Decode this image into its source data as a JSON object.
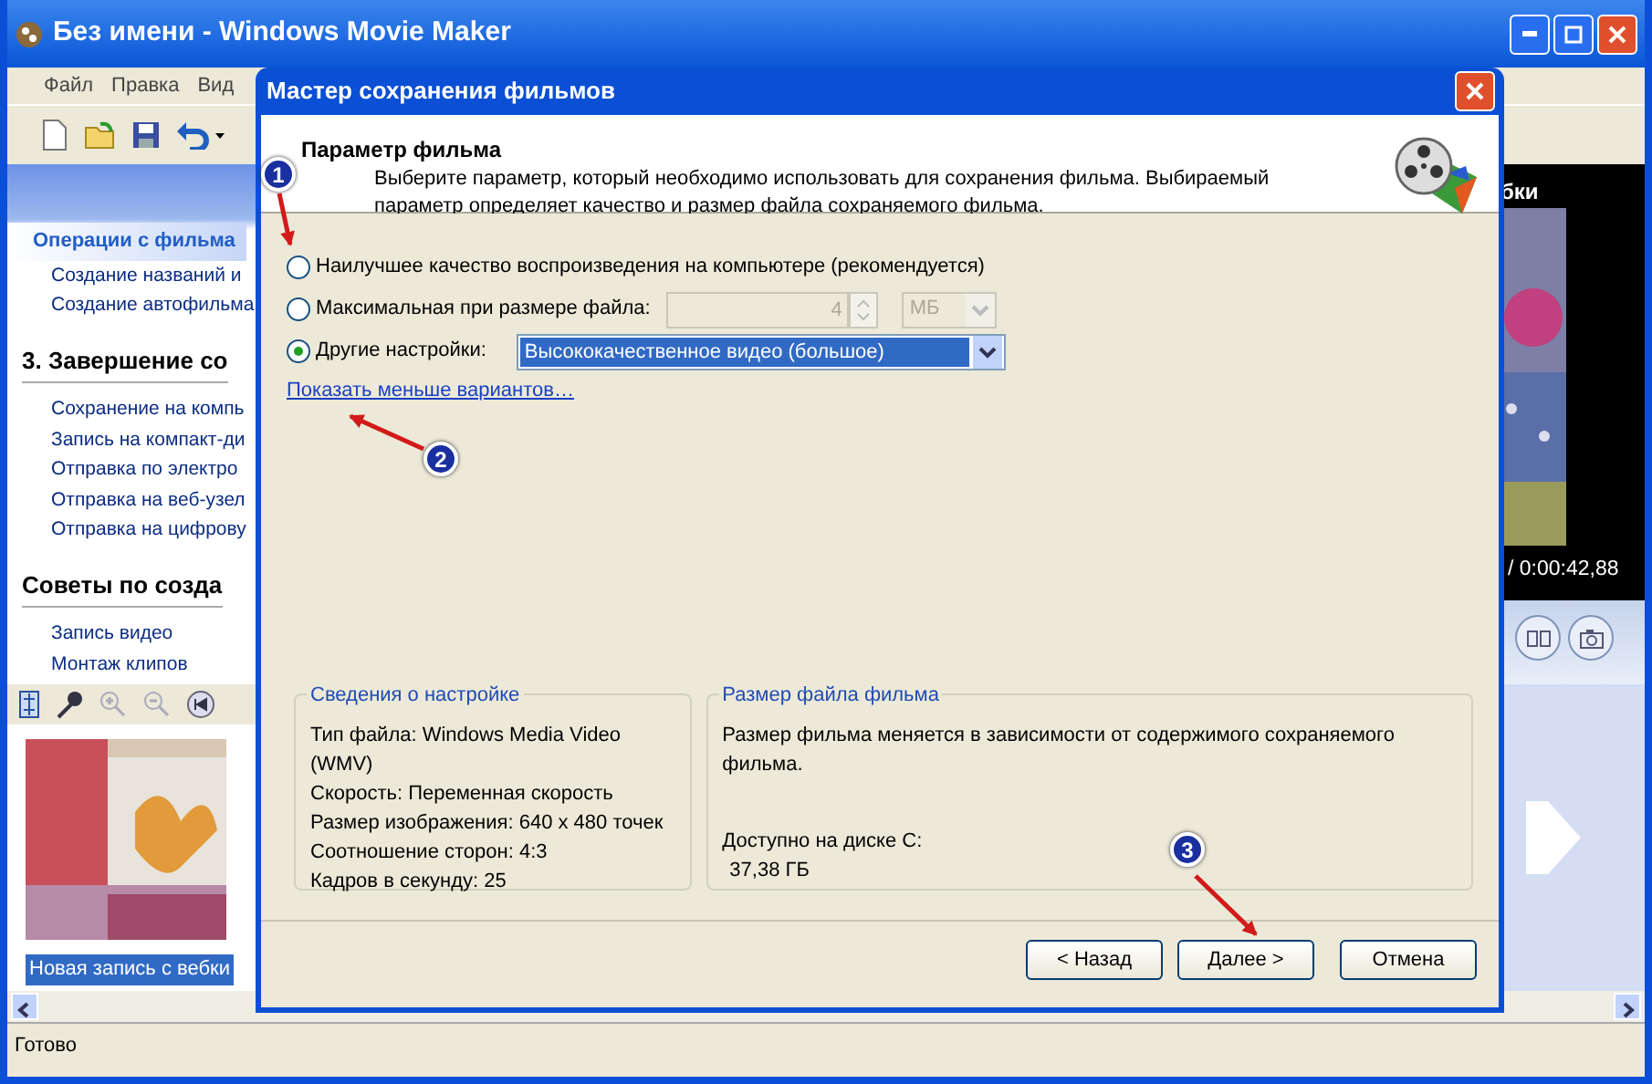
{
  "main_window": {
    "title": "Без имени - Windows Movie Maker",
    "menu": [
      "Файл",
      "Правка",
      "Вид"
    ]
  },
  "task_pane": {
    "sections": [
      {
        "title": "Операции с фильма",
        "items": [
          "Создание названий и",
          "Создание автофильма"
        ]
      },
      {
        "title": "3. Завершение со",
        "items": [
          "Сохранение на компь",
          "Запись на компакт-ди",
          "Отправка по электро",
          "Отправка на веб-узел",
          "Отправка на цифрову"
        ]
      },
      {
        "title": "Советы по созда",
        "items": [
          "Запись видео",
          "Монтаж клипов"
        ]
      }
    ]
  },
  "preview": {
    "title": "бки",
    "time": "/ 0:00:42,88"
  },
  "storyboard": {
    "clips": [
      {
        "label": "Новая запись с вебки",
        "selected": true
      }
    ]
  },
  "status_bar": "Готово",
  "dialog": {
    "title": "Мастер сохранения фильмов",
    "heading": "Параметр фильма",
    "description": "Выберите параметр, который необходимо использовать для сохранения фильма. Выбираемый параметр определяет качество и размер файла сохраняемого фильма.",
    "options": [
      {
        "kind": "plain",
        "label": "Наилучшее качество воспроизведения на компьютере (рекомендуется)",
        "selected": false
      },
      {
        "kind": "size",
        "label": "Максимальная при размере файла:",
        "selected": false,
        "value": "4",
        "unit": "МБ",
        "disabled": true
      },
      {
        "kind": "preset",
        "label": "Другие настройки:",
        "selected": true,
        "value": "Высококачественное видео (большое)"
      }
    ],
    "link": "Показать меньше вариантов…",
    "settings": {
      "title": "Сведения о настройке",
      "lines": [
        "Тип файла: Windows Media Video (WMV)",
        "Скорость: Переменная скорость",
        "Размер изображения: 640 x 480 точек",
        "Соотношение сторон: 4:3",
        "Кадров в секунду: 25"
      ]
    },
    "file_size": {
      "title": "Размер файла фильма",
      "text": "Размер фильма меняется в зависимости от содержимого сохраняемого фильма.",
      "disk_label": "Доступно на диске C:",
      "disk_value": "37,38 ГБ"
    },
    "buttons": [
      "< Назад",
      "Далее >",
      "Отмена"
    ]
  },
  "annotations": [
    {
      "number": "1"
    },
    {
      "number": "2"
    },
    {
      "number": "3"
    }
  ]
}
